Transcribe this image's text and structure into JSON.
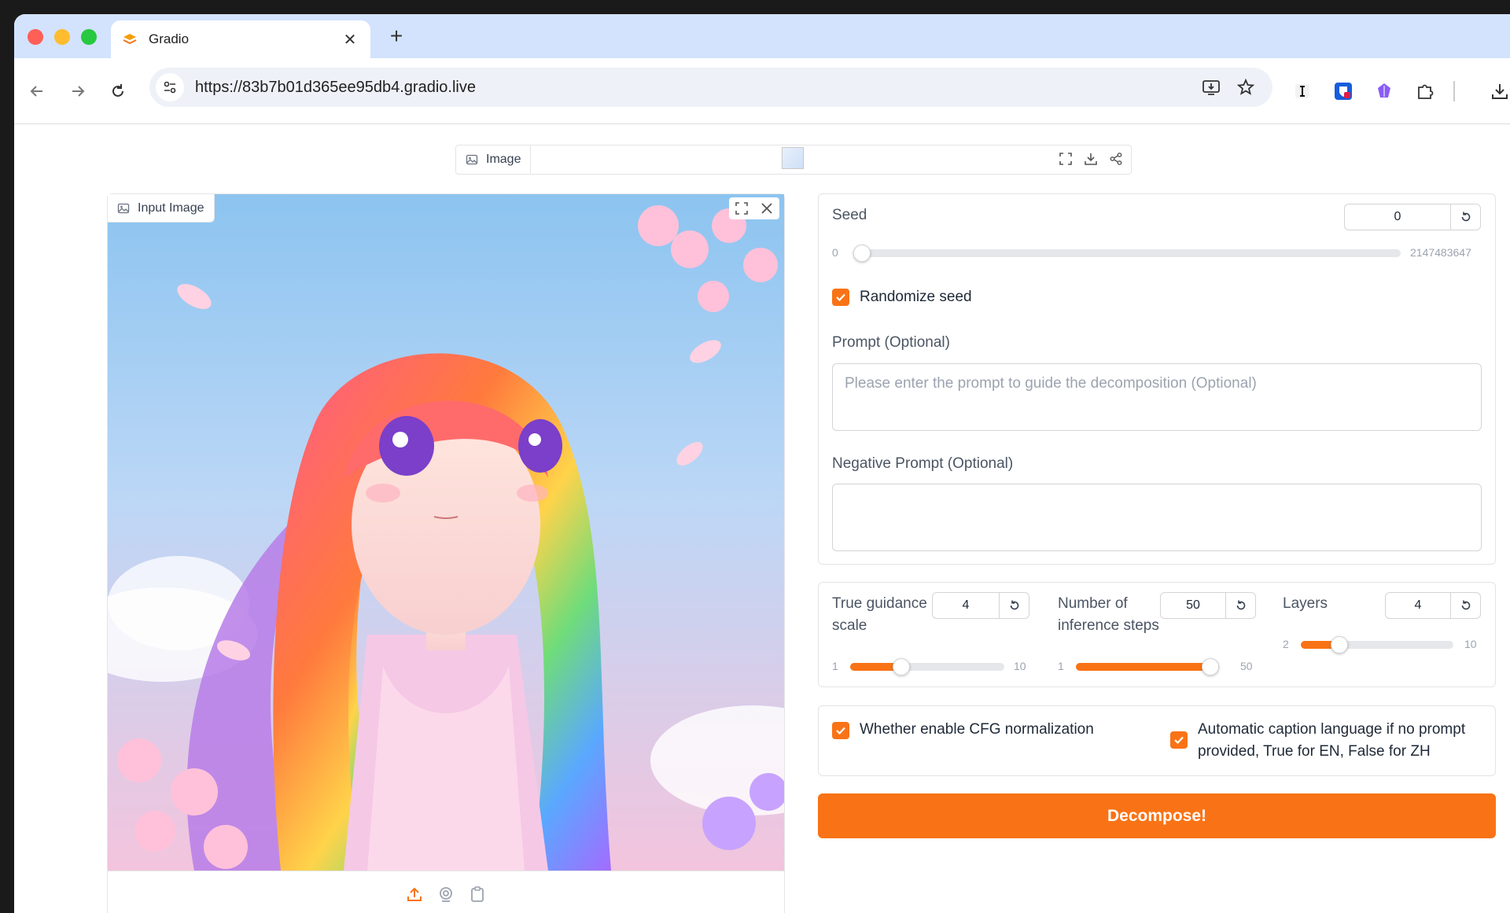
{
  "browser": {
    "tab_title": "Gradio",
    "tab_close": "✕",
    "new_tab": "+",
    "url": "https://83b7b01d365ee95db4.gradio.live",
    "extensions": [
      "install-app-icon",
      "bookmark-star-icon",
      "text-cursor-extension-icon",
      "bitwarden-extension-icon",
      "purple-shield-extension-icon",
      "puzzle-extensions-icon",
      "download-icon"
    ]
  },
  "output_image": {
    "label": "Image"
  },
  "input_image": {
    "label": "Input Image"
  },
  "seed": {
    "label": "Seed",
    "value": "0",
    "min": "0",
    "max": "2147483647",
    "fraction": 0.0
  },
  "randomize_seed": {
    "label": "Randomize seed",
    "checked": true
  },
  "prompt": {
    "label": "Prompt (Optional)",
    "placeholder": "Please enter the prompt to guide the decomposition (Optional)",
    "value": ""
  },
  "negative_prompt": {
    "label": "Negative Prompt (Optional)",
    "value": ""
  },
  "guidance": {
    "label_line1": "True guidance",
    "label_line2": "scale",
    "value": "4",
    "min": "1",
    "max": "10",
    "fraction": 0.333
  },
  "steps": {
    "label_line1": "Number of",
    "label_line2": "inference steps",
    "value": "50",
    "min": "1",
    "max": "50",
    "fraction": 1.0
  },
  "layers": {
    "label": "Layers",
    "value": "4",
    "min": "2",
    "max": "10",
    "fraction": 0.25
  },
  "cfg_norm": {
    "label": "Whether enable CFG normalization",
    "checked": true
  },
  "caption_lang": {
    "label_line1": "Automatic caption language if no prompt",
    "label_line2": "provided, True for EN, False for ZH",
    "checked": true
  },
  "submit": {
    "label": "Decompose!"
  },
  "colors": {
    "accent": "#f97316",
    "tabstrip": "#d3e3fd"
  }
}
